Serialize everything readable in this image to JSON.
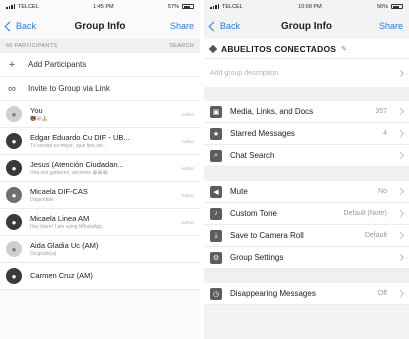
{
  "left": {
    "status": {
      "carrier": "TELCEL",
      "time": "1:45 PM",
      "battery": "57%"
    },
    "nav": {
      "back": "Back",
      "title": "Group Info",
      "share": "Share"
    },
    "participants_header": "66 PARTICIPANTS",
    "search_label": "SEARCH",
    "actions": [
      {
        "label": "Add Participants",
        "icon": "plus-icon"
      },
      {
        "label": "Invite to Group via Link",
        "icon": "link-icon"
      }
    ],
    "members": [
      {
        "name": "You",
        "sub": "🐻😀🙏",
        "role": "Admin"
      },
      {
        "name": "Edgar Eduardo Cu DIF - UB...",
        "sub": "Tu verdad es mejor, ¡que tipo ser...",
        "role": "Admin"
      },
      {
        "name": "Jesus (Atención Ciudadan...",
        "sub": "Una vez gobierno, secretos 😀😀😀",
        "role": "Admin"
      },
      {
        "name": "Micaela DIF-CAS",
        "sub": "Disponible",
        "role": "Admin"
      },
      {
        "name": "Micaela Linea AM",
        "sub": "Hey there! I am using WhatsApp.",
        "role": "Admin"
      },
      {
        "name": "Aida Gladia Uc (AM)",
        "sub": "Ocupado(a)",
        "role": ""
      },
      {
        "name": "Carmen Cruz (AM)",
        "sub": "",
        "role": ""
      }
    ]
  },
  "right": {
    "status": {
      "carrier": "TELCEL",
      "time": "10:09 PM",
      "battery": "56%"
    },
    "nav": {
      "back": "Back",
      "title": "Group Info",
      "share": "Share"
    },
    "group_name": "ABUELITOS CONECTADOS",
    "description_placeholder": "Add group description",
    "media": [
      {
        "label": "Media, Links, and Docs",
        "value": "357",
        "icon": "photo-icon"
      },
      {
        "label": "Starred Messages",
        "value": "4",
        "icon": "star-icon"
      },
      {
        "label": "Chat Search",
        "value": "",
        "icon": "search-icon"
      }
    ],
    "settings": [
      {
        "label": "Mute",
        "value": "No",
        "icon": "speaker-icon"
      },
      {
        "label": "Custom Tone",
        "value": "Default (Note)",
        "icon": "music-icon"
      },
      {
        "label": "Save to Camera Roll",
        "value": "Default",
        "icon": "download-icon"
      },
      {
        "label": "Group Settings",
        "value": "",
        "icon": "gear-icon"
      }
    ],
    "disappearing": {
      "label": "Disappearing Messages",
      "value": "Off",
      "icon": "timer-icon"
    }
  }
}
